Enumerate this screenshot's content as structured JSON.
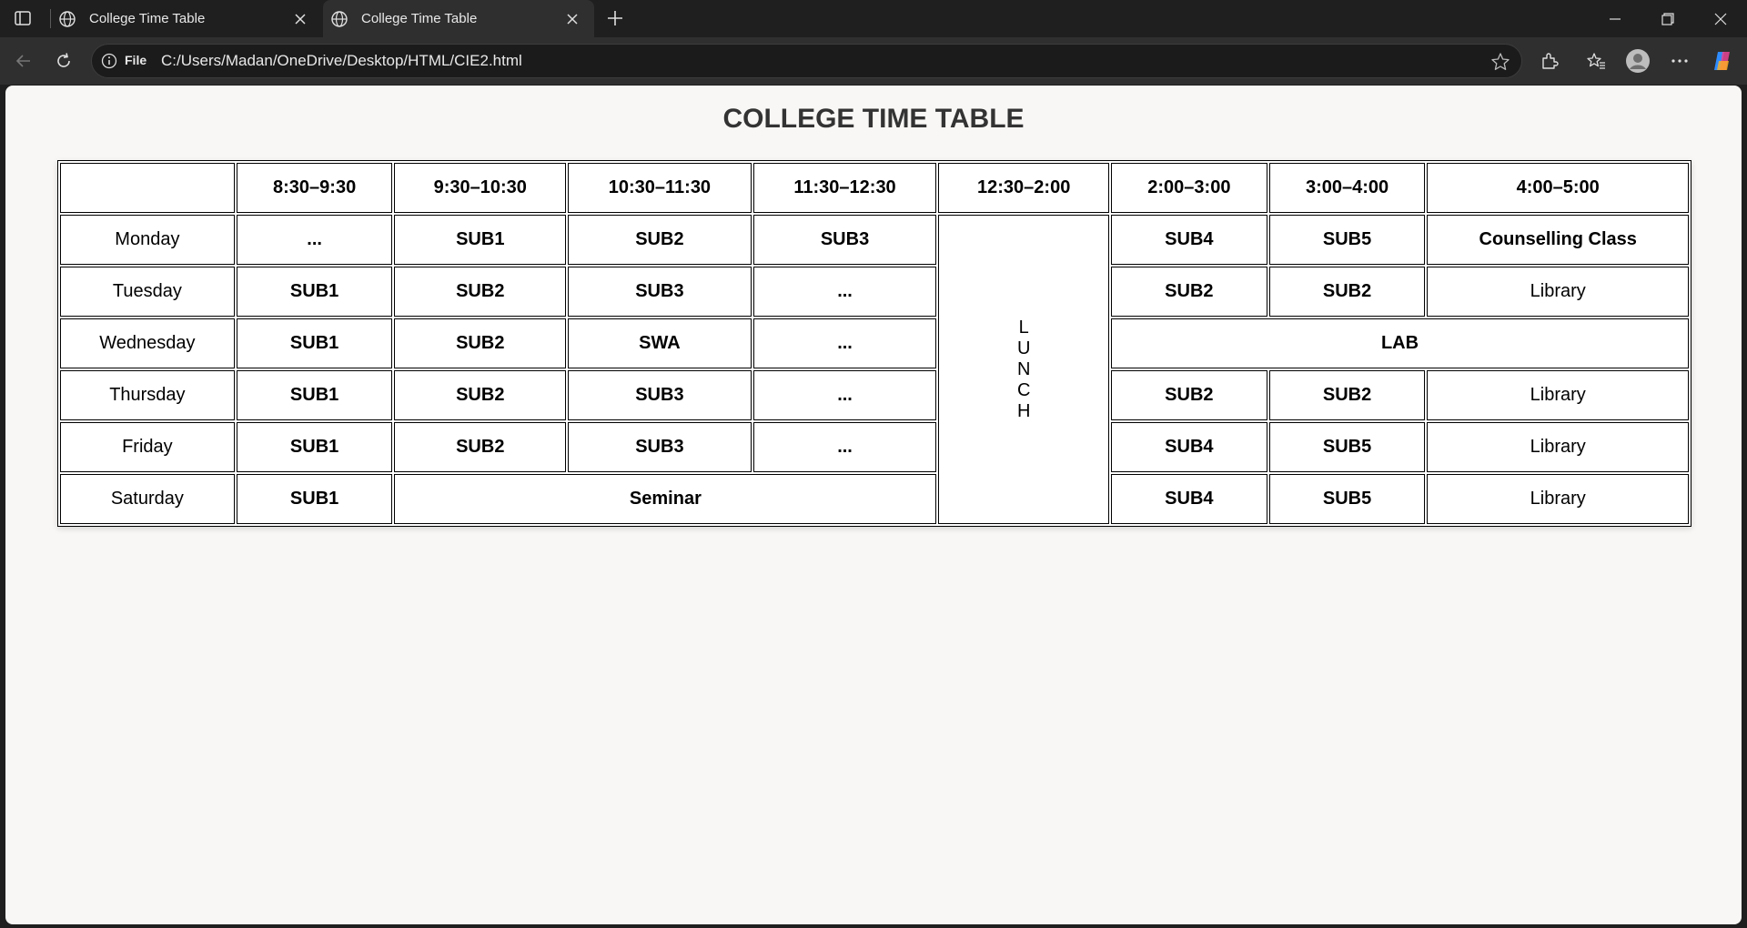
{
  "browser": {
    "tabs": [
      {
        "title": "College Time Table"
      },
      {
        "title": "College Time Table"
      }
    ],
    "address": {
      "scheme_label": "File",
      "url": "C:/Users/Madan/OneDrive/Desktop/HTML/CIE2.html"
    }
  },
  "page": {
    "title": "COLLEGE TIME TABLE",
    "headers": [
      "",
      "8:30–9:30",
      "9:30–10:30",
      "10:30–11:30",
      "11:30–12:30",
      "12:30–2:00",
      "2:00–3:00",
      "3:00–4:00",
      "4:00–5:00"
    ],
    "lunch_letters": [
      "L",
      "U",
      "N",
      "C",
      "H"
    ],
    "rows": {
      "monday": {
        "day": "Monday",
        "c1": "...",
        "c2": "SUB1",
        "c3": "SUB2",
        "c4": "SUB3",
        "c6": "SUB4",
        "c7": "SUB5",
        "c8": "Counselling Class"
      },
      "tuesday": {
        "day": "Tuesday",
        "c1": "SUB1",
        "c2": "SUB2",
        "c3": "SUB3",
        "c4": "...",
        "c6": "SUB2",
        "c7": "SUB2",
        "c8": "Library"
      },
      "wednesday": {
        "day": "Wednesday",
        "c1": "SUB1",
        "c2": "SUB2",
        "c3": "SWA",
        "c4": "...",
        "lab": "LAB"
      },
      "thursday": {
        "day": "Thursday",
        "c1": "SUB1",
        "c2": "SUB2",
        "c3": "SUB3",
        "c4": "...",
        "c6": "SUB2",
        "c7": "SUB2",
        "c8": "Library"
      },
      "friday": {
        "day": "Friday",
        "c1": "SUB1",
        "c2": "SUB2",
        "c3": "SUB3",
        "c4": "...",
        "c6": "SUB4",
        "c7": "SUB5",
        "c8": "Library"
      },
      "saturday": {
        "day": "Saturday",
        "c1": "SUB1",
        "seminar": "Seminar",
        "c6": "SUB4",
        "c7": "SUB5",
        "c8": "Library"
      }
    },
    "colors": {
      "sub1": "#1a8ad0",
      "sub2": "#ff8c1a",
      "sub3": "#e619e6",
      "sub4": "#0a7f0a",
      "sub5": "#e61c1c"
    }
  }
}
